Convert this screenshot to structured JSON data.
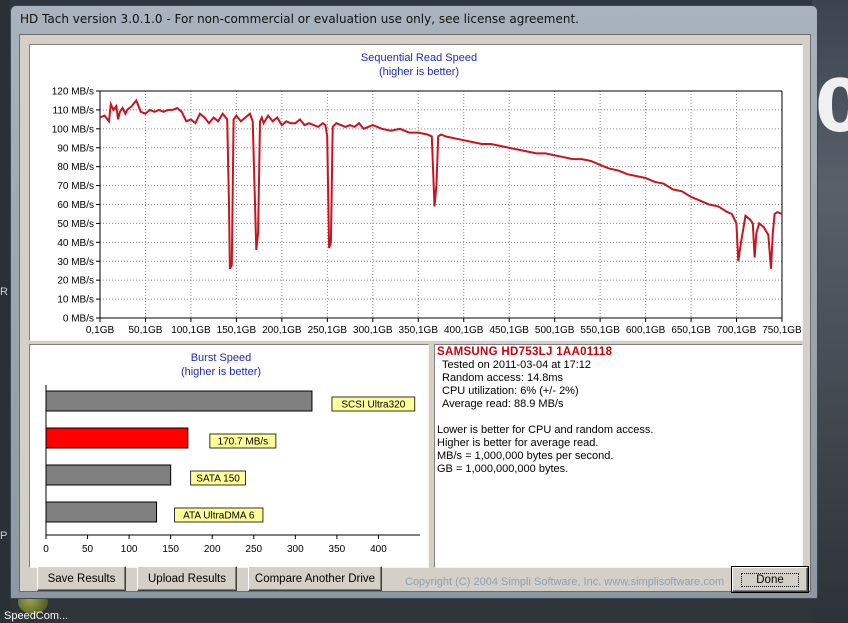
{
  "window": {
    "title": "HD Tach version 3.0.1.0  - For non-commercial or evaluation use only, see license agreement."
  },
  "desktop": {
    "big_glyph": "0",
    "left_glyphs": [
      "R",
      "P"
    ],
    "icon_label": "SpeedCom..."
  },
  "chart_data": [
    {
      "type": "line",
      "title": "Sequential Read Speed",
      "subtitle": "(higher is better)",
      "ylim": [
        0,
        120
      ],
      "xlim": [
        0.1,
        750.1
      ],
      "y_ticks": [
        "0 MB/s",
        "10 MB/s",
        "20 MB/s",
        "30 MB/s",
        "40 MB/s",
        "50 MB/s",
        "60 MB/s",
        "70 MB/s",
        "80 MB/s",
        "90 MB/s",
        "100 MB/s",
        "110 MB/s",
        "120 MB/s"
      ],
      "x_ticks": [
        "0,1GB",
        "50,1GB",
        "100,1GB",
        "150,1GB",
        "200,1GB",
        "250,1GB",
        "300,1GB",
        "350,1GB",
        "400,1GB",
        "450,1GB",
        "500,1GB",
        "550,1GB",
        "600,1GB",
        "650,1GB",
        "700,1GB",
        "750,1GB"
      ],
      "grid": true,
      "series_color": "#c8141e",
      "x": [
        0.1,
        5,
        10,
        12,
        15,
        18,
        20,
        22,
        25,
        28,
        30,
        35,
        40,
        45,
        50,
        55,
        60,
        65,
        70,
        75,
        80,
        85,
        90,
        95,
        100,
        105,
        110,
        115,
        120,
        125,
        130,
        135,
        140,
        142,
        143,
        145,
        147,
        150,
        155,
        160,
        165,
        168,
        170,
        172,
        174,
        176,
        178,
        180,
        185,
        190,
        195,
        200,
        205,
        210,
        215,
        220,
        225,
        230,
        235,
        240,
        245,
        248,
        250,
        252,
        254,
        256,
        260,
        265,
        270,
        275,
        280,
        285,
        290,
        295,
        300,
        305,
        310,
        320,
        330,
        340,
        350,
        360,
        365,
        368,
        370,
        372,
        375,
        380,
        390,
        400,
        410,
        420,
        430,
        440,
        450,
        460,
        470,
        480,
        490,
        500,
        510,
        520,
        530,
        540,
        550,
        560,
        570,
        580,
        590,
        600,
        610,
        620,
        630,
        640,
        650,
        660,
        670,
        680,
        690,
        695,
        700,
        702,
        705,
        710,
        715,
        718,
        720,
        722,
        725,
        730,
        735,
        738,
        740,
        742,
        745,
        750.1
      ],
      "y": [
        106,
        107,
        104,
        113,
        110,
        112,
        105,
        109,
        111,
        108,
        110,
        112,
        115,
        109,
        108,
        110,
        109,
        110,
        109,
        110,
        110,
        111,
        109,
        104,
        105,
        103,
        108,
        106,
        103,
        106,
        104,
        108,
        105,
        60,
        26,
        28,
        105,
        107,
        104,
        106,
        108,
        104,
        70,
        36,
        45,
        104,
        106,
        103,
        107,
        104,
        106,
        102,
        104,
        103,
        103,
        105,
        102,
        103,
        102,
        101,
        103,
        102,
        96,
        37,
        40,
        101,
        103,
        102,
        101,
        102,
        101,
        103,
        100,
        101,
        102,
        101,
        100,
        99,
        100,
        98,
        98,
        97,
        96,
        59,
        70,
        96,
        97,
        96,
        95,
        94,
        93,
        92,
        92,
        91,
        90,
        89,
        88,
        87,
        87,
        86,
        85,
        84,
        84,
        83,
        81,
        79,
        78,
        76,
        75,
        74,
        72,
        71,
        68,
        67,
        64,
        62,
        60,
        59,
        56,
        55,
        50,
        30,
        40,
        54,
        52,
        50,
        32,
        45,
        50,
        48,
        44,
        26,
        45,
        55,
        56,
        55
      ]
    },
    {
      "type": "bar",
      "title": "Burst Speed",
      "subtitle": "(higher is better)",
      "xlim": [
        0,
        450
      ],
      "x_ticks": [
        "0",
        "50",
        "100",
        "150",
        "200",
        "250",
        "300",
        "350",
        "400"
      ],
      "categories": [
        "SCSI Ultra320",
        "170.7 MB/s",
        "SATA 150",
        "ATA UltraDMA 6"
      ],
      "values": [
        320,
        170.7,
        150,
        133
      ],
      "colors": [
        "#808080",
        "#ff0000",
        "#808080",
        "#808080"
      ]
    }
  ],
  "info": {
    "drive": "SAMSUNG HD753LJ 1AA01118",
    "stats": [
      "Tested on 2011-03-04 at 17:12",
      "Random access: 14.8ms",
      "CPU utilization: 6% (+/- 2%)",
      "Average read: 88.9 MB/s"
    ],
    "notes": [
      "Lower is better for CPU and random access.",
      "Higher is better for average read.",
      "MB/s = 1,000,000 bytes per second.",
      "GB = 1,000,000,000 bytes."
    ]
  },
  "buttons": {
    "save": "Save Results",
    "upload": "Upload Results",
    "compare": "Compare Another Drive",
    "done": "Done"
  },
  "copyright": "Copyright (C) 2004 Simpli Software, Inc. www.simplisoftware.com"
}
